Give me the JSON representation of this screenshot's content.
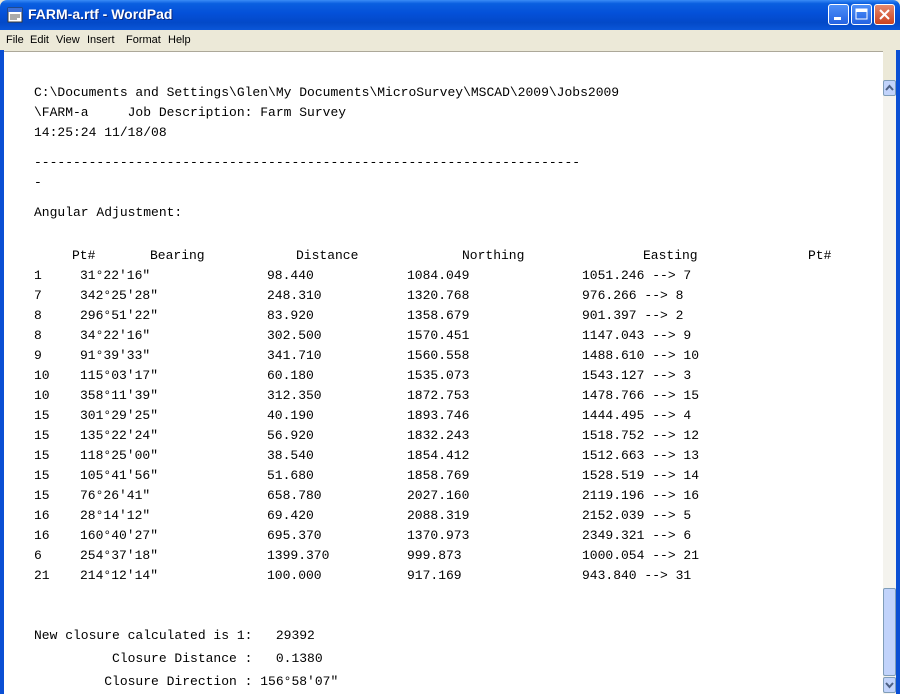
{
  "window": {
    "title": "FARM-a.rtf - WordPad"
  },
  "menu": [
    "File",
    "Edit",
    "View",
    "Insert",
    "Format",
    "Help"
  ],
  "doc": {
    "path_line": "C:\\Documents and Settings\\Glen\\My Documents\\MicroSurvey\\MSCAD\\2009\\Jobs2009",
    "job_line": "\\FARM-a     Job Description: Farm Survey",
    "timestamp": "14:25:24 11/18/08",
    "separator": "----------------------------------------------------------------------",
    "separator_tail": "-",
    "heading": "Angular Adjustment:",
    "columns": {
      "pt": "Pt#",
      "bearing": "Bearing",
      "distance": "Distance",
      "northing": "Northing",
      "easting": "Easting",
      "pt2": "Pt#"
    },
    "rows": [
      {
        "pt": "1",
        "bearing": "31°22'16\"",
        "distance": "98.440",
        "northing": "1084.049",
        "easting": "1051.246 --> 7"
      },
      {
        "pt": "7",
        "bearing": "342°25'28\"",
        "distance": "248.310",
        "northing": "1320.768",
        "easting": "976.266 --> 8"
      },
      {
        "pt": "8",
        "bearing": "296°51'22\"",
        "distance": "83.920",
        "northing": "1358.679",
        "easting": "901.397 --> 2"
      },
      {
        "pt": "8",
        "bearing": "34°22'16\"",
        "distance": "302.500",
        "northing": "1570.451",
        "easting": "1147.043 --> 9"
      },
      {
        "pt": "9",
        "bearing": "91°39'33\"",
        "distance": "341.710",
        "northing": "1560.558",
        "easting": "1488.610 --> 10"
      },
      {
        "pt": "10",
        "bearing": "115°03'17\"",
        "distance": "60.180",
        "northing": "1535.073",
        "easting": "1543.127 --> 3"
      },
      {
        "pt": "10",
        "bearing": "358°11'39\"",
        "distance": "312.350",
        "northing": "1872.753",
        "easting": "1478.766 --> 15"
      },
      {
        "pt": "15",
        "bearing": "301°29'25\"",
        "distance": "40.190",
        "northing": "1893.746",
        "easting": "1444.495 --> 4"
      },
      {
        "pt": "15",
        "bearing": "135°22'24\"",
        "distance": "56.920",
        "northing": "1832.243",
        "easting": "1518.752 --> 12"
      },
      {
        "pt": "15",
        "bearing": "118°25'00\"",
        "distance": "38.540",
        "northing": "1854.412",
        "easting": "1512.663 --> 13"
      },
      {
        "pt": "15",
        "bearing": "105°41'56\"",
        "distance": "51.680",
        "northing": "1858.769",
        "easting": "1528.519 --> 14"
      },
      {
        "pt": "15",
        "bearing": "76°26'41\"",
        "distance": "658.780",
        "northing": "2027.160",
        "easting": "2119.196 --> 16"
      },
      {
        "pt": "16",
        "bearing": "28°14'12\"",
        "distance": "69.420",
        "northing": "2088.319",
        "easting": "2152.039 --> 5"
      },
      {
        "pt": "16",
        "bearing": "160°40'27\"",
        "distance": "695.370",
        "northing": "1370.973",
        "easting": "2349.321 --> 6"
      },
      {
        "pt": "6",
        "bearing": "254°37'18\"",
        "distance": "1399.370",
        "northing": "999.873",
        "easting": "1000.054 --> 21"
      },
      {
        "pt": "21",
        "bearing": "214°12'14\"",
        "distance": "100.000",
        "northing": "917.169",
        "easting": "943.840 --> 31"
      }
    ],
    "closure_line": "New closure calculated is 1:   29392",
    "closure_distance_line": "          Closure Distance :   0.1380",
    "closure_direction_line": "         Closure Direction : 156°58'07\""
  }
}
